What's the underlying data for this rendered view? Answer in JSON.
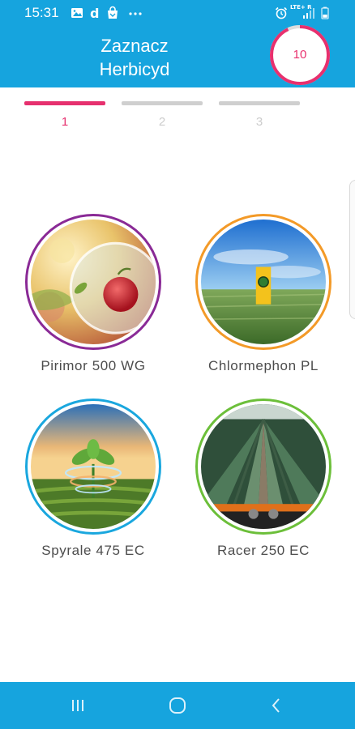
{
  "status_bar": {
    "time": "15:31",
    "network_label": "LTE+ R",
    "icons": [
      "image-icon",
      "d-app-icon",
      "shopping-bag-icon",
      "more-icon",
      "alarm-icon",
      "signal-icon",
      "battery-icon"
    ]
  },
  "header": {
    "title_line1": "Zaznacz",
    "title_line2": "Herbicyd",
    "timer_value": "10",
    "timer_remaining_fraction": 0.93,
    "accent_color": "#16a4de",
    "timer_color": "#e8306e"
  },
  "steps": [
    {
      "label": "1",
      "active": true
    },
    {
      "label": "2",
      "active": false
    },
    {
      "label": "3",
      "active": false
    }
  ],
  "products": [
    {
      "name": "Pirimor 500 WG",
      "border_color": "#8a2a96",
      "image": "apple-orchard-image"
    },
    {
      "name": "Chlormephon PL",
      "border_color": "#f39a28",
      "image": "wheat-field-image"
    },
    {
      "name": "Spyrale 475 EC",
      "border_color": "#1aa7de",
      "image": "sprout-swirl-image"
    },
    {
      "name": "Racer 250 EC",
      "border_color": "#6cbf3a",
      "image": "crop-rows-image"
    }
  ],
  "nav_bar": {
    "buttons": [
      "recent-apps-icon",
      "home-icon",
      "back-icon"
    ]
  }
}
